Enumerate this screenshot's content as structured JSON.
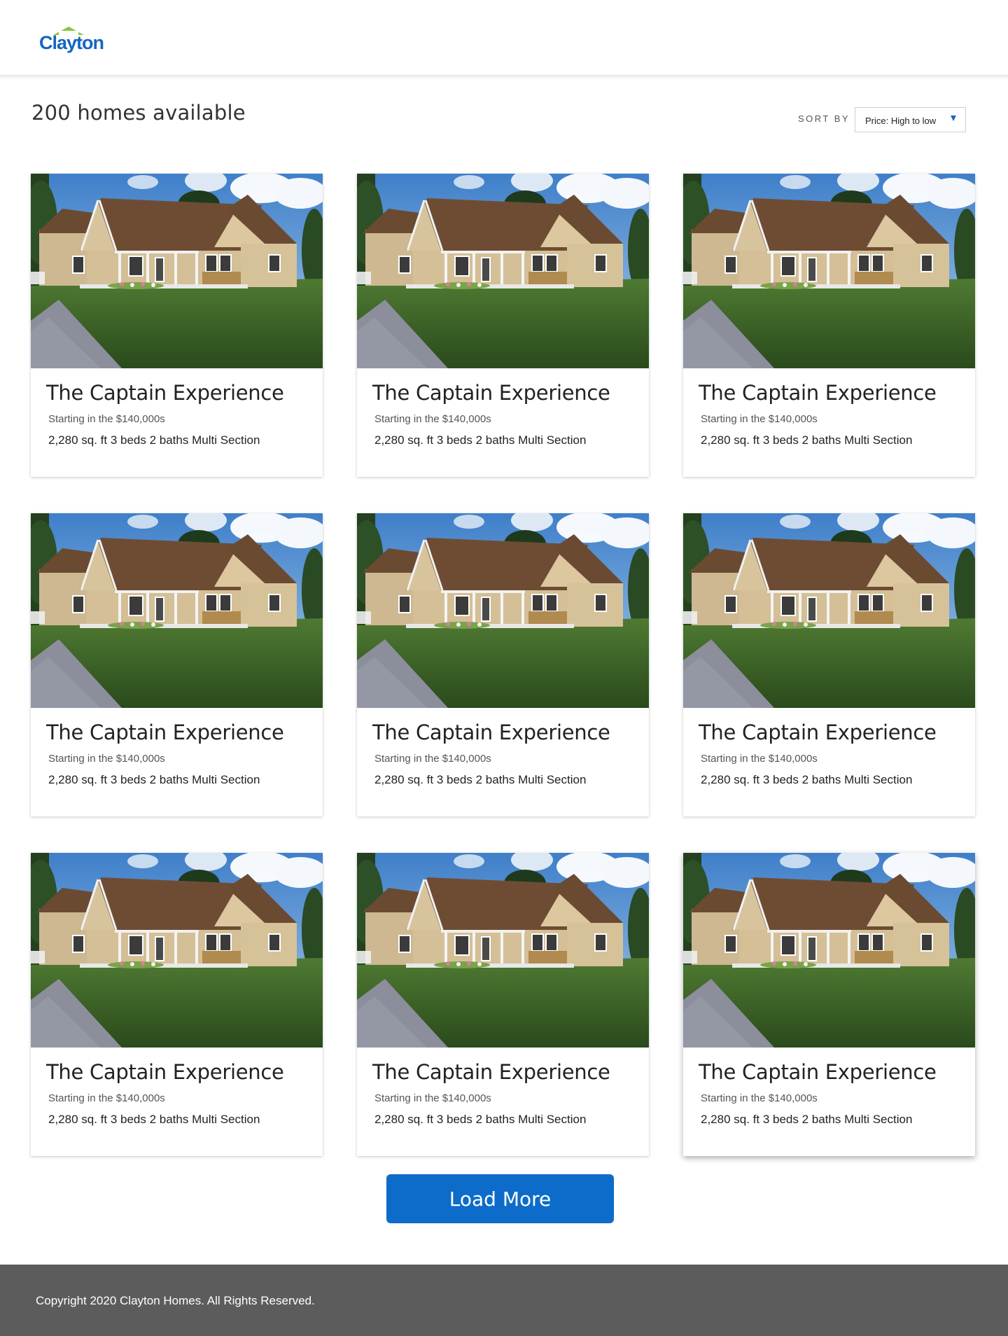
{
  "header": {
    "logo_text": "Clayton"
  },
  "toolbar": {
    "results_count": "200 homes available",
    "sort_label": "SORT BY",
    "sort_value": "Price: High to low"
  },
  "listings": [
    {
      "title": "The Captain Experience",
      "price": "Starting in the $140,000s",
      "specs": "2,280 sq. ft 3 beds 2 baths Multi Section"
    },
    {
      "title": "The Captain Experience",
      "price": "Starting in the $140,000s",
      "specs": "2,280 sq. ft 3 beds 2 baths Multi Section"
    },
    {
      "title": "The Captain Experience",
      "price": "Starting in the $140,000s",
      "specs": "2,280 sq. ft 3 beds 2 baths Multi Section"
    },
    {
      "title": "The Captain Experience",
      "price": "Starting in the $140,000s",
      "specs": "2,280 sq. ft 3 beds 2 baths Multi Section"
    },
    {
      "title": "The Captain Experience",
      "price": "Starting in the $140,000s",
      "specs": "2,280 sq. ft 3 beds 2 baths Multi Section"
    },
    {
      "title": "The Captain Experience",
      "price": "Starting in the $140,000s",
      "specs": "2,280 sq. ft 3 beds 2 baths Multi Section"
    },
    {
      "title": "The Captain Experience",
      "price": "Starting in the $140,000s",
      "specs": "2,280 sq. ft 3 beds 2 baths Multi Section"
    },
    {
      "title": "The Captain Experience",
      "price": "Starting in the $140,000s",
      "specs": "2,280 sq. ft 3 beds 2 baths Multi Section"
    },
    {
      "title": "The Captain Experience",
      "price": "Starting in the $140,000s",
      "specs": "2,280 sq. ft 3 beds 2 baths Multi Section"
    }
  ],
  "load_more_label": "Load More",
  "footer": {
    "copyright": "Copyright 2020 Clayton Homes. All Rights Reserved."
  },
  "colors": {
    "brand_blue": "#0d6cc9",
    "logo_blue": "#1565c0",
    "logo_green": "#8cc63f",
    "footer_bg": "#5c5c5c"
  }
}
